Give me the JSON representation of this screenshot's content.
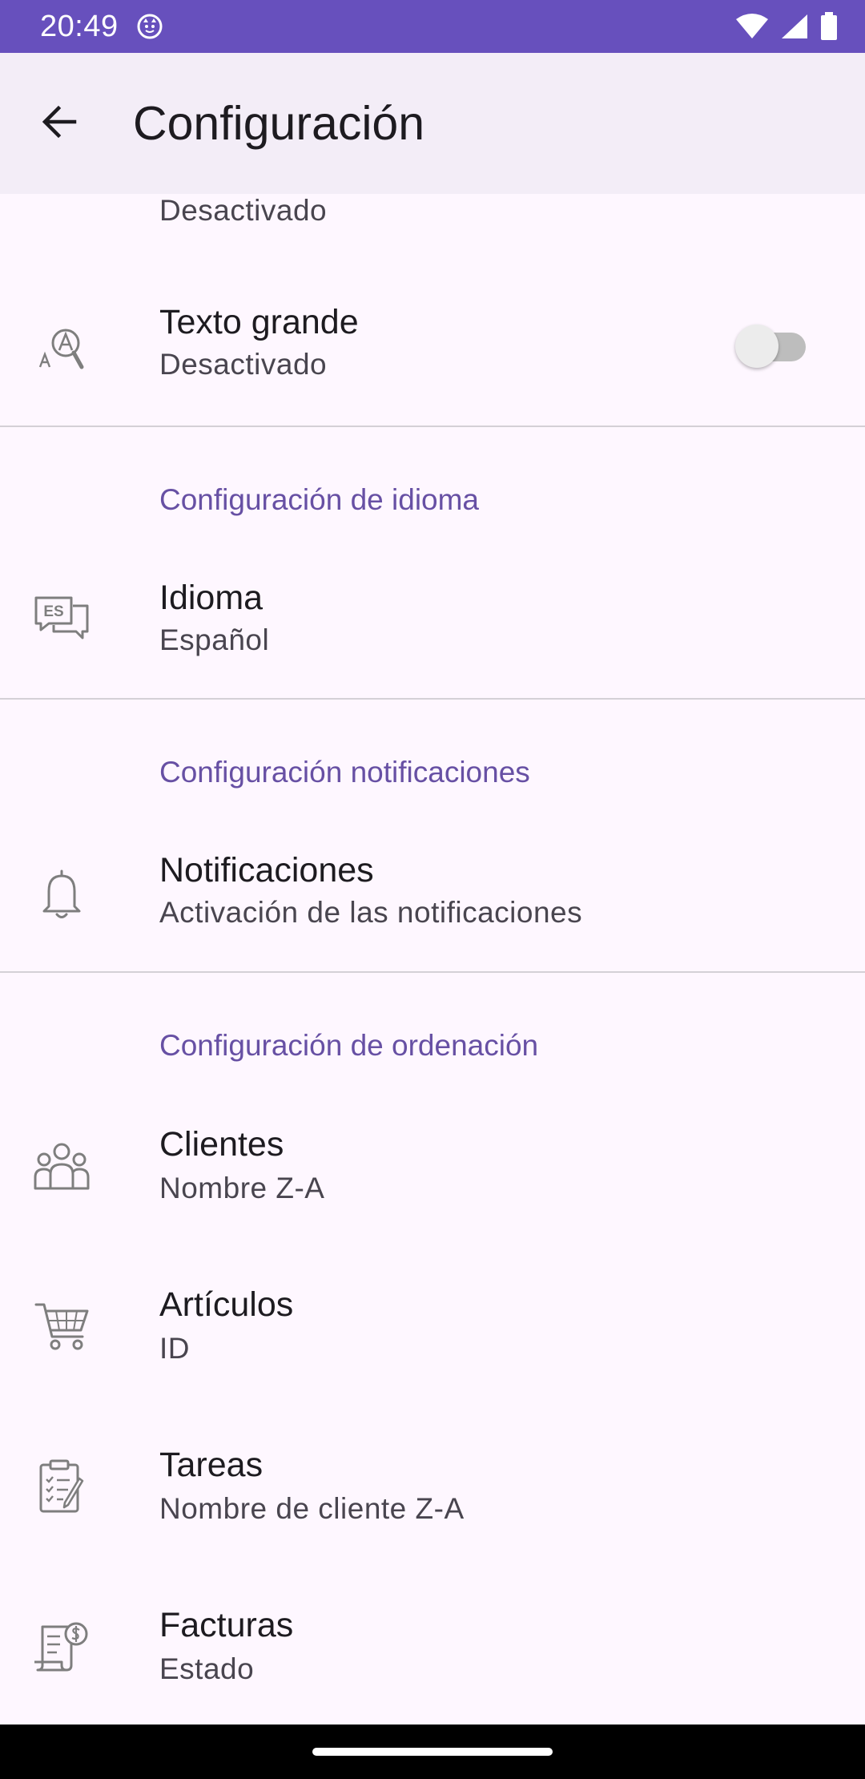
{
  "status_bar": {
    "time": "20:49"
  },
  "app_bar": {
    "title": "Configuración"
  },
  "items": {
    "partial": {
      "summary": "Desactivado"
    },
    "texto_grande": {
      "title": "Texto grande",
      "summary": "Desactivado",
      "checked": false
    },
    "idioma": {
      "title": "Idioma",
      "summary": "Español",
      "icon_text": "ES"
    },
    "notificaciones": {
      "title": "Notificaciones",
      "summary": "Activación de las notificaciones"
    },
    "clientes": {
      "title": "Clientes",
      "summary": "Nombre Z-A"
    },
    "articulos": {
      "title": "Artículos",
      "summary": "ID"
    },
    "tareas": {
      "title": "Tareas",
      "summary": "Nombre de cliente Z-A"
    },
    "facturas": {
      "title": "Facturas",
      "summary": "Estado"
    }
  },
  "categories": {
    "idioma": "Configuración de idioma",
    "notificaciones": "Configuración notificaciones",
    "ordenacion": "Configuración de ordenación"
  },
  "colors": {
    "status_bar": "#6750BD",
    "app_bar": "#F3EDF7",
    "background": "#FEF7FF",
    "accent": "#6750A4"
  }
}
